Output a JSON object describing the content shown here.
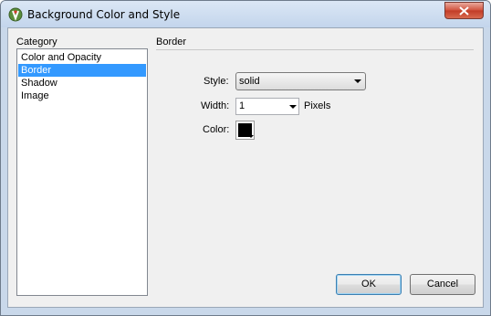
{
  "window": {
    "title": "Background Color and Style"
  },
  "category": {
    "label": "Category",
    "items": [
      {
        "label": "Color and Opacity",
        "selected": false
      },
      {
        "label": "Border",
        "selected": true
      },
      {
        "label": "Shadow",
        "selected": false
      },
      {
        "label": "Image",
        "selected": false
      }
    ]
  },
  "border": {
    "section_title": "Border",
    "style_label": "Style:",
    "style_value": "solid",
    "width_label": "Width:",
    "width_value": "1",
    "width_unit": "Pixels",
    "color_label": "Color:",
    "color_value": "#000000"
  },
  "buttons": {
    "ok": "OK",
    "cancel": "Cancel"
  },
  "colors": {
    "selection": "#3399ff",
    "titlebar": "#c9d8ea",
    "close_button": "#c13b26"
  },
  "icons": {
    "app": "app-logo-icon",
    "close": "close-icon",
    "dropdown": "chevron-down-icon"
  }
}
